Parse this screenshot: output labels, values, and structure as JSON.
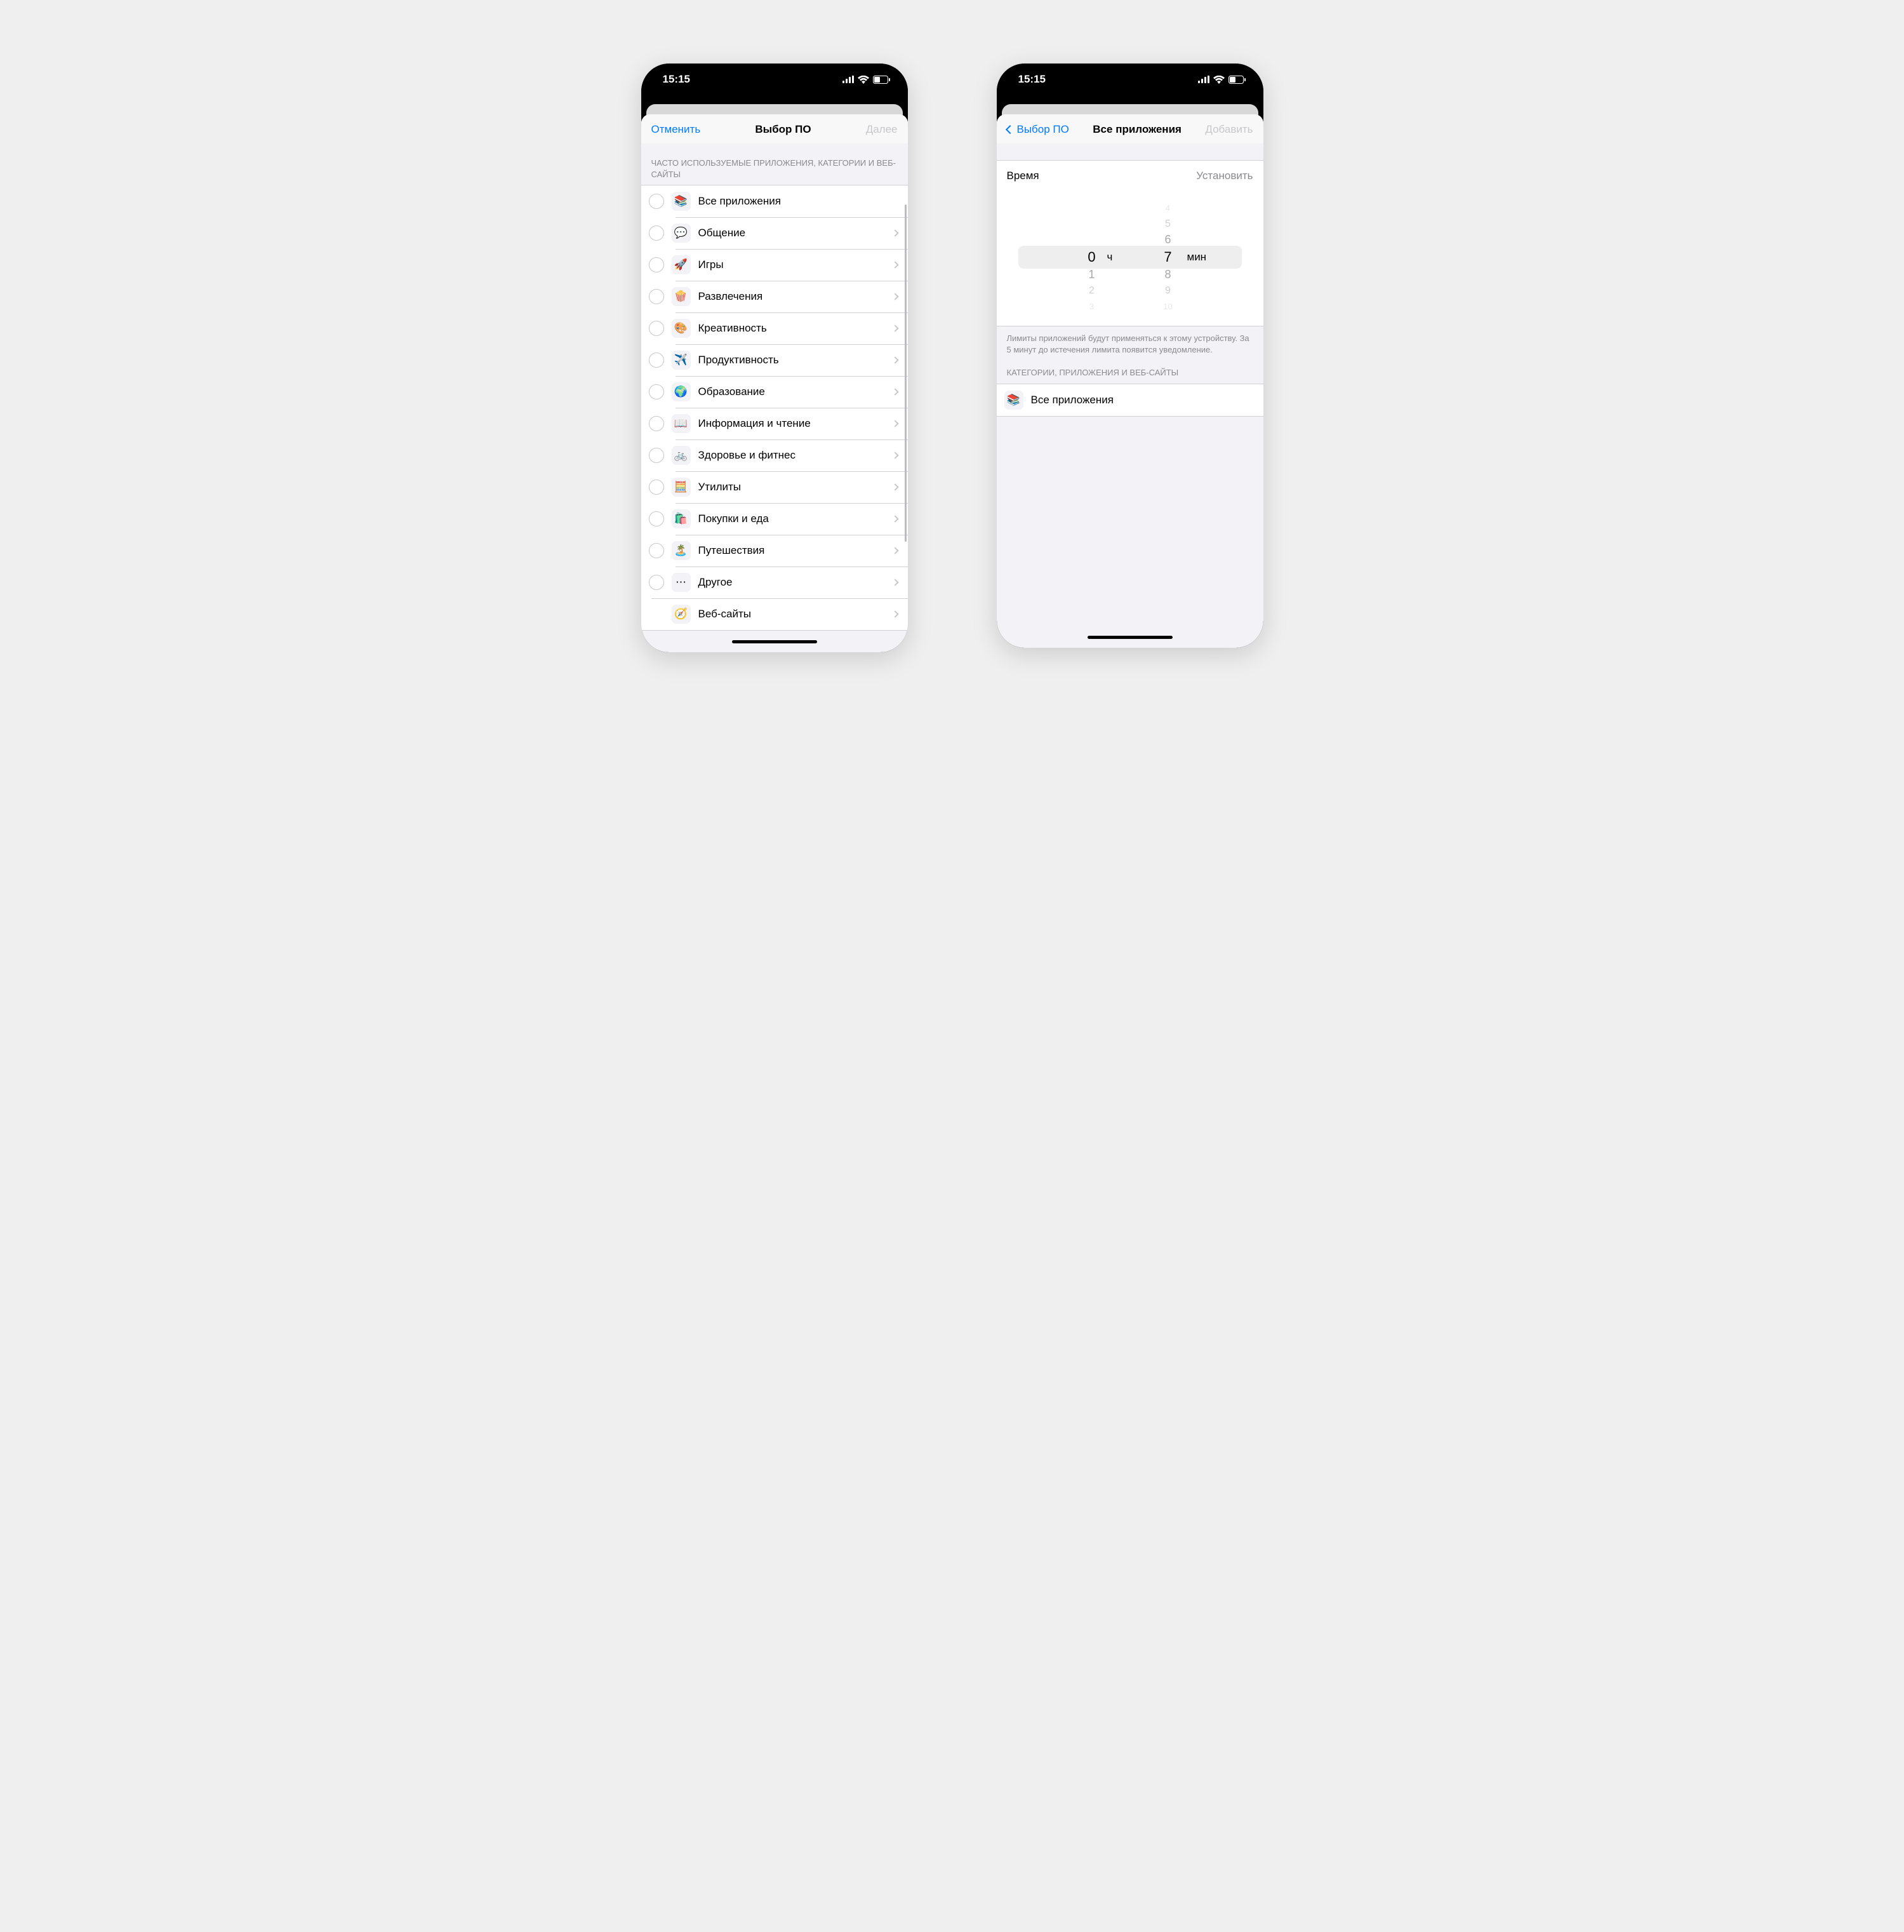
{
  "statusbar": {
    "time": "15:15"
  },
  "left": {
    "nav": {
      "cancel": "Отменить",
      "title": "Выбор ПО",
      "next": "Далее"
    },
    "section_header": "ЧАСТО ИСПОЛЬЗУЕМЫЕ ПРИЛОЖЕНИЯ, КАТЕГОРИИ И ВЕБ-САЙТЫ",
    "rows": [
      {
        "icon": "📚",
        "label": "Все приложения",
        "chevron": false,
        "radio": true
      },
      {
        "icon": "💬",
        "label": "Общение",
        "chevron": true,
        "radio": true
      },
      {
        "icon": "🚀",
        "label": "Игры",
        "chevron": true,
        "radio": true
      },
      {
        "icon": "🍿",
        "label": "Развлечения",
        "chevron": true,
        "radio": true
      },
      {
        "icon": "🎨",
        "label": "Креативность",
        "chevron": true,
        "radio": true
      },
      {
        "icon": "✈️",
        "label": "Продуктивность",
        "chevron": true,
        "radio": true
      },
      {
        "icon": "🌍",
        "label": "Образование",
        "chevron": true,
        "radio": true
      },
      {
        "icon": "📖",
        "label": "Информация и чтение",
        "chevron": true,
        "radio": true
      },
      {
        "icon": "🚲",
        "label": "Здоровье и фитнес",
        "chevron": true,
        "radio": true
      },
      {
        "icon": "🧮",
        "label": "Утилиты",
        "chevron": true,
        "radio": true
      },
      {
        "icon": "🛍️",
        "label": "Покупки и еда",
        "chevron": true,
        "radio": true
      },
      {
        "icon": "🏝️",
        "label": "Путешествия",
        "chevron": true,
        "radio": true
      },
      {
        "icon": "⋯",
        "label": "Другое",
        "chevron": true,
        "radio": true
      },
      {
        "icon": "🧭",
        "label": "Веб-сайты",
        "chevron": true,
        "radio": false
      }
    ]
  },
  "right": {
    "nav": {
      "back": "Выбор ПО",
      "title": "Все приложения",
      "action": "Добавить"
    },
    "time_row": {
      "label": "Время",
      "action": "Установить"
    },
    "picker": {
      "hours": {
        "selected": "0",
        "below": [
          "1",
          "2",
          "3"
        ],
        "unit": "ч"
      },
      "minutes": {
        "above": [
          "4",
          "5",
          "6"
        ],
        "selected": "7",
        "below": [
          "8",
          "9",
          "10"
        ],
        "unit": "мин"
      }
    },
    "footer": "Лимиты приложений будут применяться к этому устройству. За 5 минут до истечения лимита появится уведомление.",
    "section2_header": "КАТЕГОРИИ, ПРИЛОЖЕНИЯ И ВЕБ-САЙТЫ",
    "section2_rows": [
      {
        "icon": "📚",
        "label": "Все приложения"
      }
    ]
  }
}
